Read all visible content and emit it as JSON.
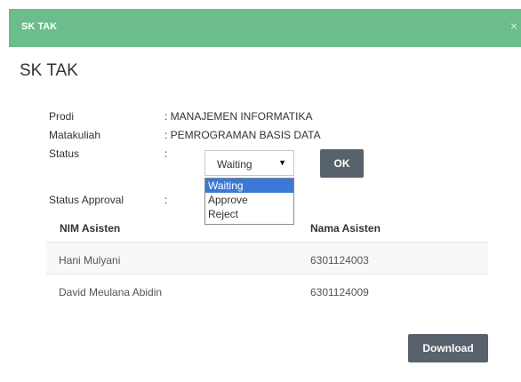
{
  "header": {
    "title": "SK TAK",
    "close": "×"
  },
  "page": {
    "title": "SK TAK"
  },
  "info": {
    "prodi_label": "Prodi",
    "prodi_value": ": MANAJEMEN INFORMATIKA",
    "matakuliah_label": "Matakuliah",
    "matakuliah_value": ": PEMROGRAMAN BASIS DATA",
    "status_label": "Status",
    "status_colon": ":",
    "approval_label": "Status Approval",
    "approval_colon": ":"
  },
  "status_select": {
    "selected": "Waiting",
    "options": [
      "Waiting",
      "Approve",
      "Reject"
    ]
  },
  "buttons": {
    "ok": "OK",
    "download": "Download"
  },
  "table": {
    "headers": [
      "NIM Asisten",
      "Nama Asisten"
    ],
    "rows": [
      [
        "Hani Mulyani",
        "6301124003"
      ],
      [
        "David Meulana Abidin",
        "6301124009"
      ]
    ]
  },
  "colors": {
    "header_bg": "#6bbd8c",
    "button_bg": "#57626c",
    "option_highlight": "#3b78d8"
  },
  "icons": {
    "caret": "caret-down-icon",
    "close": "close-icon"
  }
}
